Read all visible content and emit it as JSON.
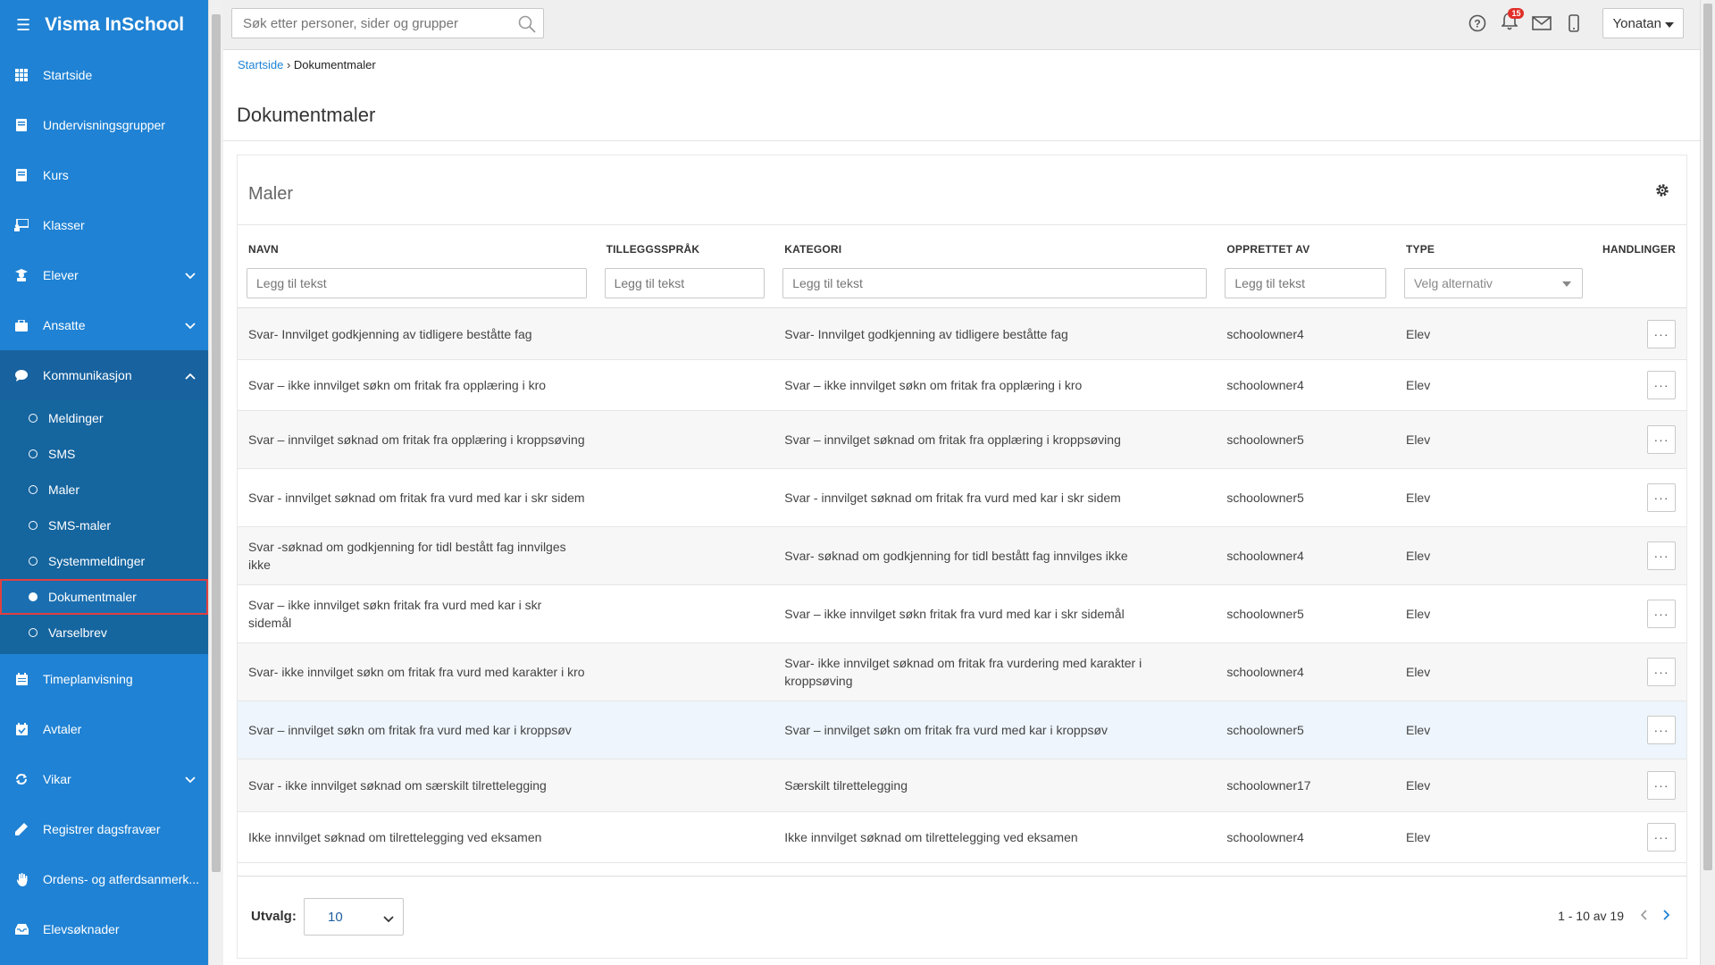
{
  "app": {
    "title": "Visma InSchool"
  },
  "sidebar": {
    "items": [
      {
        "label": "Startside"
      },
      {
        "label": "Undervisningsgrupper"
      },
      {
        "label": "Kurs"
      },
      {
        "label": "Klasser"
      },
      {
        "label": "Elever"
      },
      {
        "label": "Ansatte"
      },
      {
        "label": "Kommunikasjon"
      },
      {
        "label": "Timeplanvisning"
      },
      {
        "label": "Avtaler"
      },
      {
        "label": "Vikar"
      },
      {
        "label": "Registrer dagsfravær"
      },
      {
        "label": "Ordens- og atferdsanmerk..."
      },
      {
        "label": "Elevsøknader"
      }
    ],
    "sub": [
      {
        "label": "Meldinger"
      },
      {
        "label": "SMS"
      },
      {
        "label": "Maler"
      },
      {
        "label": "SMS-maler"
      },
      {
        "label": "Systemmeldinger"
      },
      {
        "label": "Dokumentmaler"
      },
      {
        "label": "Varselbrev"
      }
    ]
  },
  "topbar": {
    "search_placeholder": "Søk etter personer, sider og grupper",
    "notification_count": "15",
    "user": "Yonatan"
  },
  "breadcrumb": {
    "home": "Startside",
    "current": "Dokumentmaler"
  },
  "page_title": "Dokumentmaler",
  "card_title": "Maler",
  "table": {
    "headers": {
      "name": "NAVN",
      "lang": "TILLEGGSSPRÅK",
      "category": "KATEGORI",
      "created_by": "OPPRETTET AV",
      "type": "TYPE",
      "actions": "HANDLINGER"
    },
    "filter_placeholder": "Legg til tekst",
    "type_placeholder": "Velg alternativ",
    "action_glyph": "···",
    "rows": [
      {
        "name": "Svar- Innvilget godkjenning av tidligere beståtte fag",
        "category": "Svar- Innvilget godkjenning av tidligere beståtte fag",
        "created_by": "schoolowner4",
        "type": "Elev"
      },
      {
        "name": "Svar – ikke innvilget søkn om fritak fra opplæring i kro",
        "category": "Svar – ikke innvilget søkn om fritak fra opplæring i kro",
        "created_by": "schoolowner4",
        "type": "Elev"
      },
      {
        "name": "Svar – innvilget søknad om fritak fra opplæring i kroppsøving",
        "category": "Svar – innvilget søknad om fritak fra opplæring i kroppsøving",
        "created_by": "schoolowner5",
        "type": "Elev"
      },
      {
        "name": "Svar - innvilget søknad om fritak fra vurd med kar i skr sidem",
        "category": "Svar - innvilget søknad om fritak fra vurd med kar i skr sidem",
        "created_by": "schoolowner5",
        "type": "Elev"
      },
      {
        "name": "Svar -søknad om godkjenning for tidl bestått fag innvilges ikke",
        "category": "Svar- søknad om godkjenning for tidl bestått fag innvilges ikke",
        "created_by": "schoolowner4",
        "type": "Elev"
      },
      {
        "name": "Svar – ikke innvilget søkn fritak fra vurd med kar i skr sidemål",
        "category": "Svar – ikke innvilget søkn fritak fra vurd med kar i skr sidemål",
        "created_by": "schoolowner5",
        "type": "Elev"
      },
      {
        "name": "Svar- ikke innvilget søkn om fritak fra vurd med karakter i kro",
        "category": "Svar- ikke innvilget søknad om fritak fra vurdering med karakter i kroppsøving",
        "created_by": "schoolowner4",
        "type": "Elev"
      },
      {
        "name": "Svar – innvilget søkn om fritak fra vurd med kar i kroppsøv",
        "category": "Svar – innvilget søkn om fritak fra vurd med kar i kroppsøv",
        "created_by": "schoolowner5",
        "type": "Elev"
      },
      {
        "name": "Svar - ikke innvilget søknad om særskilt tilrettelegging",
        "category": "Særskilt tilrettelegging",
        "created_by": "schoolowner17",
        "type": "Elev"
      },
      {
        "name": "Ikke innvilget søknad om tilrettelegging ved eksamen",
        "category": "Ikke innvilget søknad om tilrettelegging ved eksamen",
        "created_by": "schoolowner4",
        "type": "Elev"
      }
    ]
  },
  "footer": {
    "utvalg_label": "Utvalg:",
    "page_size": "10",
    "range": "1 - 10 av 19"
  },
  "colors": {
    "sidebar": "#1f82d4",
    "accent": "#1f82d4",
    "badge": "#e0302a"
  }
}
